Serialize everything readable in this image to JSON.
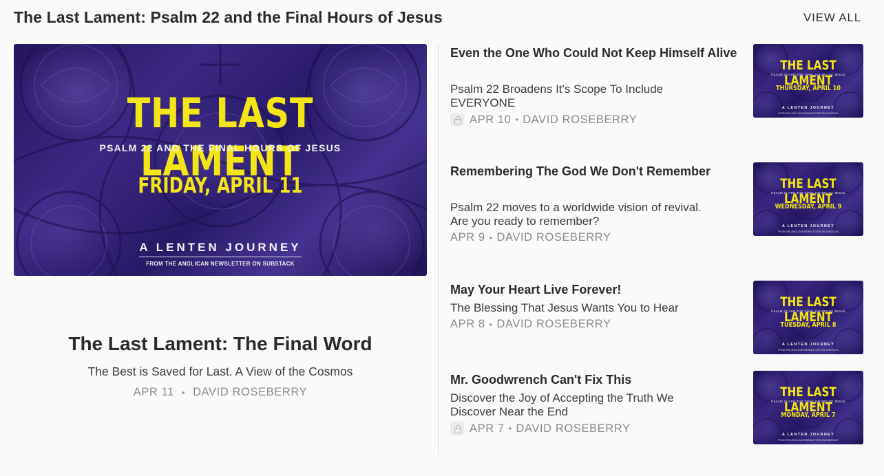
{
  "section": {
    "title": "The Last Lament: Psalm 22 and the Final Hours of Jesus",
    "view_all": "VIEW ALL"
  },
  "cover_text": {
    "title": "THE LAST LAMENT",
    "subtitle": "PSALM 22 AND THE FINAL HOURS OF JESUS",
    "journey": "A LENTEN JOURNEY",
    "from": "FROM THE ANGLICAN NEWSLETTER ON SUBSTACK"
  },
  "featured": {
    "cover_date": "FRIDAY, APRIL 11",
    "title": "The Last Lament: The Final Word",
    "subtitle": "The Best is Saved for Last. A View of the Cosmos",
    "date": "APR 11",
    "separator": "•",
    "author": "DAVID ROSEBERRY"
  },
  "posts": [
    {
      "title": "Even the One Who Could Not Keep Himself Alive",
      "subtitle": "Psalm 22 Broadens It's Scope To Include EVERYONE",
      "date": "APR 10",
      "separator": "•",
      "author": "DAVID ROSEBERRY",
      "locked": true,
      "cover_date": "THURSDAY, APRIL 10",
      "cover_title": "THE LAST LAMENT",
      "cover_subtitle": "PSALM 22 AND THE FINAL HOURS OF JESUS",
      "cover_journey": "A LENTEN JOURNEY",
      "cover_from": "FROM THE ANGLICAN NEWSLETTER ON SUBSTACK"
    },
    {
      "title": "Remembering The God We Don't Remember",
      "subtitle": "Psalm 22 moves to a worldwide vision of revival. Are you ready to remember?",
      "date": "APR 9",
      "separator": "•",
      "author": "DAVID ROSEBERRY",
      "locked": false,
      "cover_date": "WEDNESDAY, APRIL 9",
      "cover_title": "THE LAST LAMENT",
      "cover_subtitle": "PSALM 22 AND THE FINAL HOURS OF JESUS",
      "cover_journey": "A LENTEN JOURNEY",
      "cover_from": "FROM THE ANGLICAN NEWSLETTER ON SUBSTACK"
    },
    {
      "title": "May Your Heart Live Forever!",
      "subtitle": "The Blessing That Jesus Wants You to Hear",
      "date": "APR 8",
      "separator": "•",
      "author": "DAVID ROSEBERRY",
      "locked": false,
      "cover_date": "TUESDAY, APRIL 8",
      "cover_title": "THE LAST LAMENT",
      "cover_subtitle": "PSALM 22 AND THE FINAL HOURS OF JESUS",
      "cover_journey": "A LENTEN JOURNEY",
      "cover_from": "FROM THE ANGLICAN NEWSLETTER ON SUBSTACK"
    },
    {
      "title": "Mr. Goodwrench Can't Fix This",
      "subtitle": "Discover the Joy of Accepting the Truth We Discover Near the End",
      "date": "APR 7",
      "separator": "•",
      "author": "DAVID ROSEBERRY",
      "locked": true,
      "cover_date": "MONDAY, APRIL 7",
      "cover_title": "THE LAST LAMENT",
      "cover_subtitle": "PSALM 22 AND THE FINAL HOURS OF JESUS",
      "cover_journey": "A LENTEN JOURNEY",
      "cover_from": "FROM THE ANGLICAN NEWSLETTER ON SUBSTACK"
    }
  ],
  "colors": {
    "cover_purple": "#3a2688",
    "cover_yellow": "#f3e614",
    "meta_gray": "#8a8a8a",
    "background": "#fafafa"
  }
}
